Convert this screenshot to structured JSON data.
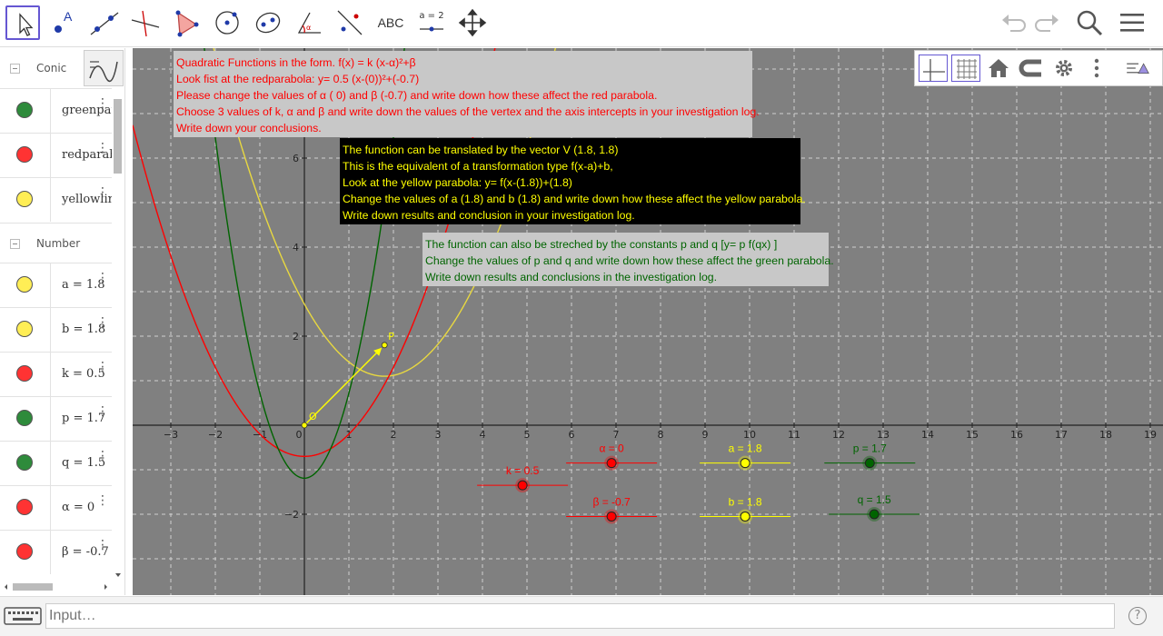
{
  "toolbar": {
    "tools": [
      {
        "name": "move-tool"
      },
      {
        "name": "point-tool",
        "label": "A"
      },
      {
        "name": "line-tool"
      },
      {
        "name": "perpendicular-tool"
      },
      {
        "name": "polygon-tool"
      },
      {
        "name": "circle-tool"
      },
      {
        "name": "conic-tool"
      },
      {
        "name": "angle-tool",
        "label": "α"
      },
      {
        "name": "reflect-tool"
      },
      {
        "name": "text-tool",
        "label": "ABC"
      },
      {
        "name": "slider-tool",
        "label": "a = 2"
      },
      {
        "name": "move-graphics-tool"
      }
    ]
  },
  "algebra": {
    "groups": [
      {
        "label": "Conic",
        "items": [
          {
            "text": "greenparabola",
            "color": "#2e8b3b"
          },
          {
            "text": "redparabola",
            "color": "#ff3333"
          },
          {
            "text": "yellowline",
            "color": "#ffee55"
          }
        ]
      },
      {
        "label": "Number",
        "items": [
          {
            "text": "a = 1.8",
            "color": "#ffee55"
          },
          {
            "text": "b = 1.8",
            "color": "#ffee55"
          },
          {
            "text": "k = 0.5",
            "color": "#ff3333"
          },
          {
            "text": "p = 1.7",
            "color": "#2e8b3b"
          },
          {
            "text": "q = 1.5",
            "color": "#2e8b3b"
          },
          {
            "text": "α = 0",
            "color": "#ff3333"
          },
          {
            "text": "β = -0.7",
            "color": "#ff3333"
          }
        ]
      }
    ]
  },
  "graphics": {
    "textbox_red": [
      "Quadratic Functions in the form. f(x) = k (x-α)²+β",
      "Look fist at the redparabola: y= 0.5 (x-(0))²+(-0.7)",
      "Please change the values of α ( 0) and β (-0.7) and write down how these affect the red parabola.",
      "Choose 3 values of k, α and β and write down the values of the vertex and the axis intercepts in your investigation log.",
      "Write down your conclusions."
    ],
    "textbox_yellow": [
      "The function can be translated by the vector V (1.8, 1.8)",
      "This is the equivalent of a transformation type f(x-a)+b,",
      "Look at the yellow parabola: y= f(x-(1.8))+(1.8)",
      "Change the values of a (1.8) and b (1.8) and write down how these affect the yellow parabola.",
      "Write down results and conclusion in your investigation log."
    ],
    "textbox_green": [
      "The function can also be streched by the constants p and q [y= p f(qx) ]",
      "Change the values of p and q and write down how these affect the green parabola.",
      "Write down results and conclusions in the investigation log."
    ],
    "x_ticks": [
      "−3",
      "−2",
      "−1",
      "0",
      "1",
      "2",
      "3",
      "4",
      "5",
      "6",
      "7",
      "8",
      "9",
      "10",
      "11",
      "12",
      "13",
      "14",
      "15",
      "16",
      "17",
      "18",
      "19"
    ],
    "y_ticks": [
      {
        "v": 6,
        "label": "6"
      },
      {
        "v": 4,
        "label": "4"
      },
      {
        "v": 2,
        "label": "2"
      },
      {
        "v": -2,
        "label": "−2"
      }
    ],
    "point_O": "O",
    "point_P": "P",
    "sliders": [
      {
        "label": "k = 0.5",
        "x": 4.9,
        "y": -1.35,
        "color": "#ff0000"
      },
      {
        "label": "α = 0",
        "x": 6.9,
        "y": -0.85,
        "color": "#ff0000"
      },
      {
        "label": "β = -0.7",
        "x": 6.9,
        "y": -2.05,
        "color": "#ff0000"
      },
      {
        "label": "a = 1.8",
        "x": 9.9,
        "y": -0.85,
        "color": "#ffff00"
      },
      {
        "label": "b = 1.8",
        "x": 9.9,
        "y": -2.05,
        "color": "#ffff00"
      },
      {
        "label": "p = 1.7",
        "x": 12.7,
        "y": -0.85,
        "color": "#006400"
      },
      {
        "label": "q = 1.5",
        "x": 12.8,
        "y": -2.0,
        "color": "#006400"
      }
    ],
    "curves": {
      "red": {
        "k": 0.5,
        "alpha": 0,
        "beta": -0.7,
        "color": "#ff0000"
      },
      "yellow": {
        "a": 1.8,
        "b": 1.8,
        "color": "#e8d840"
      },
      "green": {
        "p": 1.7,
        "q": 1.5,
        "color": "#006400"
      }
    }
  },
  "input": {
    "placeholder": "Input…"
  },
  "help": "?"
}
